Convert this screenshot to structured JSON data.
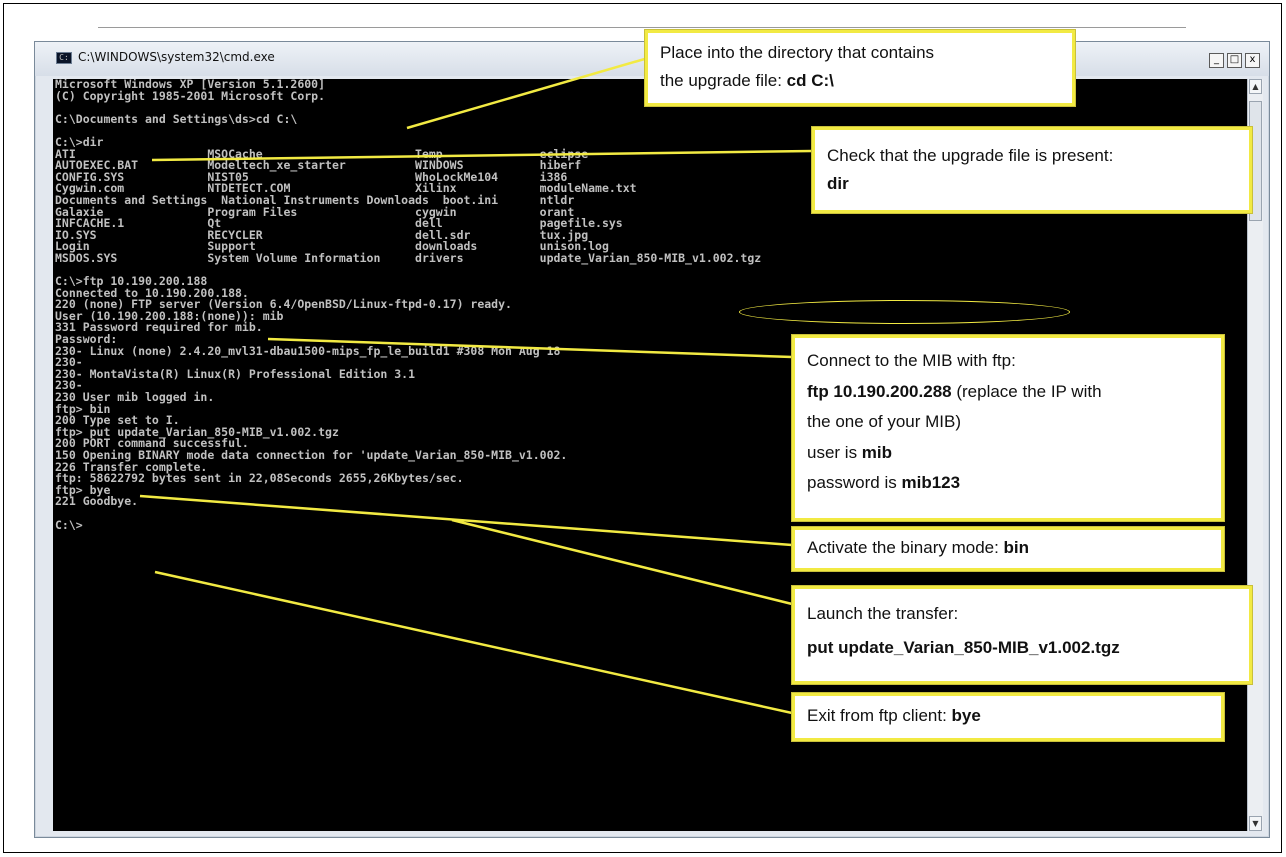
{
  "window": {
    "title": "C:\\WINDOWS\\system32\\cmd.exe",
    "icon": "cmd-icon",
    "buttons": {
      "minimize": "_",
      "maximize": "□",
      "close": "x"
    }
  },
  "terminal": {
    "lines": [
      "Microsoft Windows XP [Version 5.1.2600]",
      "(C) Copyright 1985-2001 Microsoft Corp.",
      "",
      "C:\\Documents and Settings\\ds>cd C:\\",
      "",
      "C:\\>dir",
      "ATI                   MSOCache                      Temp              eclipse",
      "AUTOEXEC.BAT          Modeltech_xe_starter          WINDOWS           hiberf",
      "CONFIG.SYS            NIST05                        WhoLockMe104      i386",
      "Cygwin.com            NTDETECT.COM                  Xilinx            moduleName.txt",
      "Documents and Settings  National Instruments Downloads  boot.ini      ntldr",
      "Galaxie               Program Files                 cygwin            orant",
      "INFCACHE.1            Qt                            dell              pagefile.sys",
      "IO.SYS                RECYCLER                      dell.sdr          tux.jpg",
      "Login                 Support                       downloads         unison.log",
      "MSDOS.SYS             System Volume Information     drivers           update_Varian_850-MIB_v1.002.tgz",
      "",
      "C:\\>ftp 10.190.200.188",
      "Connected to 10.190.200.188.",
      "220 (none) FTP server (Version 6.4/OpenBSD/Linux-ftpd-0.17) ready.",
      "User (10.190.200.188:(none)): mib",
      "331 Password required for mib.",
      "Password:",
      "230- Linux (none) 2.4.20_mvl31-dbau1500-mips_fp_le_build1 #308 Mon Aug 18",
      "230-",
      "230- MontaVista(R) Linux(R) Professional Edition 3.1",
      "230-",
      "230 User mib logged in.",
      "ftp> bin",
      "200 Type set to I.",
      "ftp> put update_Varian_850-MIB_v1.002.tgz",
      "200 PORT command successful.",
      "150 Opening BINARY mode data connection for 'update_Varian_850-MIB_v1.002.",
      "226 Transfer complete.",
      "ftp: 58622792 bytes sent in 22,08Seconds 2655,26Kbytes/sec.",
      "ftp> bye",
      "221 Goodbye.",
      "",
      "C:\\>"
    ]
  },
  "callouts": {
    "cd": {
      "line1": "Place into the directory that contains",
      "line2_prefix": "the upgrade file: ",
      "line2_cmd": "cd C:\\"
    },
    "dir": {
      "line1": "Check that the upgrade file is present:",
      "line2": "dir"
    },
    "ftp": {
      "line1": "Connect to the MIB with ftp:",
      "line2_cmd": "ftp 10.190.200.288",
      "line2_rest": " (replace the IP with",
      "line3": "the one of your MIB)",
      "line4_prefix": "user is ",
      "line4_value": "mib",
      "line5_prefix": "password is ",
      "line5_value": "mib123"
    },
    "bin": {
      "prefix": "Activate the binary mode: ",
      "cmd": "bin"
    },
    "put": {
      "line1": "Launch the transfer:",
      "line2": "put update_Varian_850-MIB_v1.002.tgz"
    },
    "bye": {
      "prefix": "Exit from ftp client: ",
      "cmd": "bye"
    }
  },
  "colors": {
    "callout_border": "#f2ea43",
    "console_bg": "#000000",
    "console_text": "#c0c0c0"
  }
}
